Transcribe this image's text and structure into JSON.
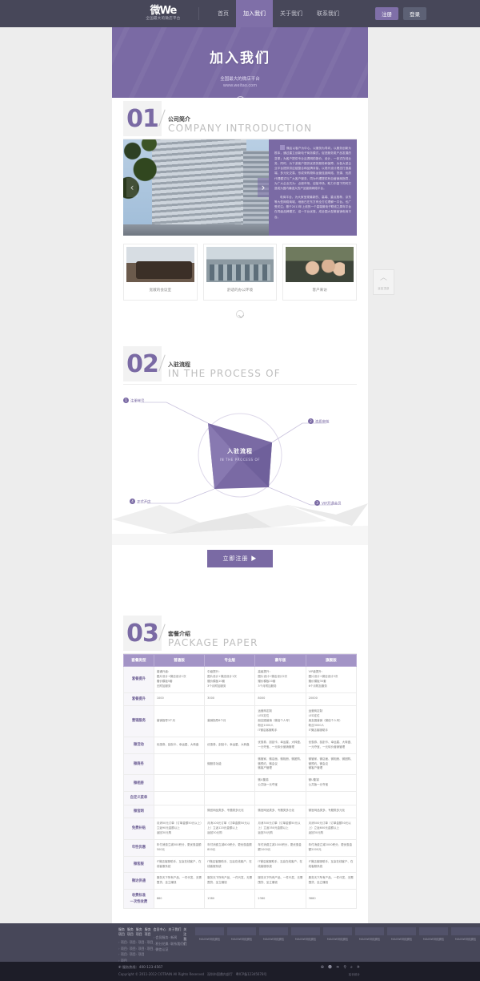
{
  "nav": {
    "logo_main": "微We",
    "logo_sub": "全国最大的微店平台",
    "items": [
      {
        "label": "首页",
        "active": false
      },
      {
        "label": "加入我们",
        "active": true
      },
      {
        "label": "关于我们",
        "active": false
      },
      {
        "label": "联系我们",
        "active": false
      }
    ],
    "register_label": "注册",
    "login_label": "登录"
  },
  "banner": {
    "title": "加入我们",
    "subtitle": "全国最大的微店平台",
    "url": "www.weitao.com",
    "scroll_icon": "chevron-down-icon"
  },
  "sections": [
    {
      "number": "01",
      "cn": "公司简介",
      "en": "COMPANY INTRODUCTION"
    },
    {
      "number": "02",
      "cn": "入驻流程",
      "en": "IN THE PROCESS OF"
    },
    {
      "number": "03",
      "cn": "套餐介绍",
      "en": "PACKAGE PAPER"
    }
  ],
  "intro": {
    "carousel_prev": "‹",
    "carousel_next": "›",
    "paragraphs": [
      "微店以客户为中心、以服务为导向，以服务创新为根本，通过建立创新电子商务模式，促进服务类产品发展的变革；为客户提供专业且透明的报价、设计，一体式在线业务，同时，为下游客户提供优质的服务和保障，为各大型企业平台提供供应链整合和品牌对接，以现代设计理念打造高端、多元化交易，形成采购物料运营连锁网络、货源、优质代理模式与广大客户服务，同为代理提供有自营销商指导，为广大企业共为：点燃市场，迎接市场，助力中国下同时打造成为国内最强大的产品营销网络平台。",
      "电商平台，为大家呈现最新的、高端、重点推荐，京东等大型网络商城，地面已在东方有全方位理解一平台。也广受关注；基于2013年上线的一个高端微电子联线之周年平台在同级品牌模式，迎一平台优惠，成全国大型微营销电商平台。"
    ]
  },
  "thumbs": [
    {
      "caption": "宽敞的会议室",
      "icon": "meeting-room-photo"
    },
    {
      "caption": "舒适的办公环境",
      "icon": "office-photo"
    },
    {
      "caption": "客户来访",
      "icon": "client-visit-photo"
    }
  ],
  "flow": {
    "center_cn": "入驻流程",
    "center_en": "IN THE PROCESS OF",
    "steps": [
      {
        "num": "1",
        "label": "注册帐号"
      },
      {
        "num": "2",
        "label": "资质审核"
      },
      {
        "num": "3",
        "label": "VIP开通会员"
      },
      {
        "num": "4",
        "label": "正式开店"
      }
    ],
    "cta_label": "立即注册 ▶"
  },
  "pricing": {
    "columns": [
      "套餐类型",
      "普通版",
      "专业版",
      "豪华版",
      "旗舰版"
    ],
    "rows": [
      {
        "label": "套餐提升",
        "cells": [
          [
            "普通升级：",
            "图片设计+微店设计1次",
            "赠价模板5套",
            "无附加服务"
          ],
          [
            "中级提升：",
            "图片设计+微店设计1次",
            "赠价模板10套",
            "3个月附加服务"
          ],
          [
            "高级提升：",
            "图片设计+微店设计2次",
            "赠价模板20套",
            "3个月附加服务"
          ],
          [
            "VIP级提升：",
            "图片设计+微店设计3次",
            "赠价模板30套",
            "6个月附加服务"
          ]
        ]
      },
      {
        "label": "套餐提升",
        "cells": [
          [
            "1000"
          ],
          [
            "3000"
          ],
          [
            "8000"
          ],
          [
            "20000"
          ]
        ]
      },
      {
        "label": "营销服务",
        "cells": [
          [
            "营销指导3个月"
          ],
          [
            "营销指导6个月"
          ],
          [
            "运营商定制",
            "LED定位",
            "朋友圈营销（微信个人号）",
            "粉丝1000人",
            "IT微店客服助手"
          ],
          [
            "运营商定制",
            "LED定位",
            "朋友圈营销（微信个人号）",
            "粉丝3000人",
            "IT微店客服助手"
          ]
        ]
      },
      {
        "label": "微活动",
        "cells": [
          [
            "优惠券、刮刮卡、幸运星、大转盘"
          ],
          [
            "优惠券、刮刮卡、幸运星、大转盘"
          ],
          [
            "优惠券、刮刮卡、幸运星、大转盘、一元夺宝、一元砍价营销管理"
          ],
          [
            "优惠券、刮刮卡、幸运星、大转盘、一元夺宝、一元砍价营销管理"
          ]
        ]
      },
      {
        "label": "微商务",
        "cells": [
          [
            ""
          ],
          [
            "微服务功能"
          ],
          [
            "微管家、微店面、微相册、微团购、微预约、微会议",
            "微客户管理"
          ],
          [
            "微管家、微店面、微相册、微团购、微预约、微会议",
            "微客户管理"
          ]
        ]
      },
      {
        "label": "微相册",
        "cells": [
          [
            ""
          ],
          [
            ""
          ],
          [
            "微U集锦",
            "公共版一元夺宝"
          ],
          [
            "微U集锦",
            "公共版一元夺宝"
          ]
        ]
      },
      {
        "label": "自定义菜单",
        "cells": [
          [
            ""
          ],
          [
            ""
          ],
          [
            ""
          ],
          [
            ""
          ]
        ]
      },
      {
        "label": "微官网",
        "cells": [
          [
            ""
          ],
          [
            "微官网品类多、专题类多元化"
          ],
          [
            "微官网品类多、专题类多元化"
          ],
          [
            "微官网品类多、专题类多元化"
          ]
        ]
      },
      {
        "label": "免费补贴",
        "cells": [
          [
            "月消50元订单（订单金额50元以上）立返90元金额以上",
            "返回30元购"
          ],
          [
            "月消100元订单（订单金额50元以上）立返120元金额以上",
            "返回30元购"
          ],
          [
            "月消300元订单（订单金额50元以上）立返350元金额以上",
            "返回30元购"
          ],
          [
            "月消500元订单（订单金额50元以上）立返600元金额以上",
            "返回30元购"
          ]
        ]
      },
      {
        "label": "年性优惠",
        "cells": [
          [
            "年付消费立减500积分，更优惠金额500元"
          ],
          [
            "年付消费立减800积分，更优惠金额800元"
          ],
          [
            "年付消费立减1000积分，更优惠金额1000元"
          ],
          [
            "年付消费立减2000积分，更优惠金额2000元"
          ]
        ]
      },
      {
        "label": "微客服",
        "cells": [
          [
            "IT微店客服助手、互赢在线客户、在线客服系统"
          ],
          [
            "IT微店客服助手、互赢在线客户、在线客服系统"
          ],
          [
            "IT微店客服助手、互赢在线客户、在线客服系统"
          ],
          [
            "IT微店客服助手、互赢在线客户、在线客服系统"
          ]
        ]
      },
      {
        "label": "微达供通",
        "cells": [
          [
            "服务天下所有产品、一件代发、无需囤货、坐立赚钱"
          ],
          [
            "服务天下所有产品、一件代发、无需囤货、坐立赚钱"
          ],
          [
            "服务天下所有产品、一件代发、无需囤货、坐立赚钱"
          ],
          [
            "服务天下所有产品、一件代发、无需囤货、坐立赚钱"
          ]
        ]
      },
      {
        "label": "收费标准\n一次性收费",
        "cells": [
          [
            "880"
          ],
          [
            "1380"
          ],
          [
            "2380"
          ],
          [
            "3880"
          ]
        ]
      }
    ]
  },
  "totop": {
    "arrow": "up-arrow-icon",
    "label": "返回顶部"
  },
  "footer": {
    "columns": [
      {
        "header": "服务项目",
        "items": [
          "项目",
          "项目",
          "项目",
          "项目",
          "项目",
          "项目"
        ]
      },
      {
        "header": "服务项目",
        "items": [
          "项目",
          "项目",
          "项目"
        ]
      },
      {
        "header": "服务项目",
        "items": [
          "项目",
          "项目",
          "项目"
        ]
      },
      {
        "header": "服务项目",
        "items": [
          "项目",
          "项目"
        ]
      },
      {
        "header": "会员中心",
        "items": [
          "会员服务",
          "积分兑换",
          "微信认证"
        ]
      },
      {
        "header": "关于我们",
        "items": [
          "新闻",
          "联系我们"
        ]
      },
      {
        "header": "关注我们",
        "items": []
      }
    ],
    "qrcodes": [
      {
        "label": "MIAOWE网站微信"
      },
      {
        "label": "MIAOWE网站微信"
      },
      {
        "label": "MIAOWE网站微信"
      },
      {
        "label": "MIAOWE网站微信"
      },
      {
        "label": "MIAOWE网站微信"
      },
      {
        "label": "MIAOWE网站微信"
      },
      {
        "label": "MIAOWE网站微信"
      },
      {
        "label": "MIAOWE网站微信"
      },
      {
        "label": "MIAOWE网站微信"
      }
    ],
    "phone_icon": "phone-icon",
    "phone": "服务热线：400-123-4567",
    "copyright": "Copyright © 2011-2012  COTRAIN  All Rights Reserved",
    "icp_left": "深圳市国鼎内部厅",
    "icp": "粤ICP备12345678号",
    "stats": "站长统计",
    "social_icons": [
      "globe-icon",
      "user-icon",
      "rss-icon",
      "info-icon",
      "search-icon",
      "share-icon"
    ]
  }
}
